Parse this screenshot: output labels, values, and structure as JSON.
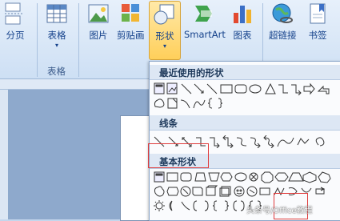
{
  "ribbon": {
    "buttons": {
      "page_break": "分页",
      "table": "表格",
      "picture": "图片",
      "clipart": "剪贴画",
      "shapes": "形状",
      "smartart": "SmartArt",
      "chart": "图表",
      "hyperlink": "超链接",
      "bookmark": "书签"
    },
    "groups": {
      "tables": "表格"
    }
  },
  "shapes_menu": {
    "recent_header": "最近使用的形状",
    "lines_header": "线条",
    "basic_header": "基本形状"
  },
  "watermark": "头条号/Office教程",
  "colors": {
    "highlight": "#e03c3c",
    "ribbon": "#dbe8f8",
    "active_button": "#ffcf5a"
  }
}
